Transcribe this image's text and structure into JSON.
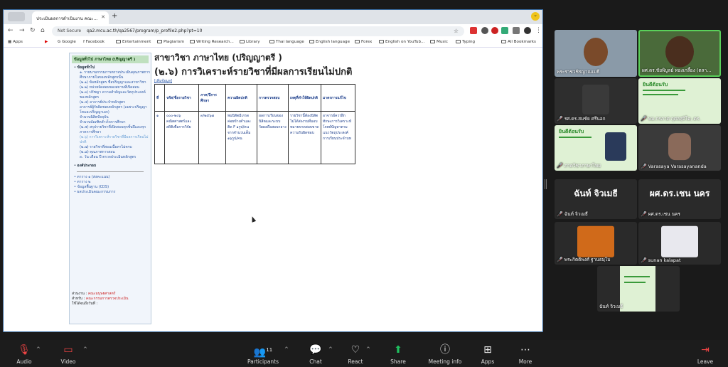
{
  "browser": {
    "tab_title": "ประเมินผลการดำเนินงาน คณะ...",
    "security_label": "Not Secure",
    "url": "qa2.mcu.ac.th/qa2567/program/p_profile2.php?pt=10",
    "bookmarks": [
      "Apps",
      "Google",
      "Facebook",
      "Entertainment",
      "Plagiarism",
      "Writing Research...",
      "Library",
      "Thai language",
      "English language",
      "Forex",
      "English on YouTub...",
      "Music",
      "Typing",
      "All Bookmarks"
    ]
  },
  "leftnav": {
    "heading": "ข้อมูลทั่วไป ภาษาไทย (ปริญญาตรี )",
    "group1": "ข้อมูลทั่วไป",
    "items": [
      "๑. รายนามกรรมการตรวจประเมินคุณภาพการศึกษาภายในของหลักสูตรนั้น",
      "(๒.๑) ข้อหลักสูตร ชื่อปริญญาและสาขาวิชา",
      "(๒.๒) หน่วยจัดสอนของสถานที่เปิดสอน",
      "(๒.๓) ปรัชญา ความสำคัญและวัตถุประสงค์ของหลักสูตร",
      "(๒.๔) อาจารย์ประจำหลักสูตร",
      "อาจารย์ผู้รับผิดชอบหลักสูตร (เฉพาะปริญญาโทและปริญญาเอก)",
      "จำนวนนิสิตปัจจุบัน",
      "จำนวนบัณฑิตสำเร็จการศึกษา",
      "(๒.๕) สรุปรายวิชาที่เปิดสอนทุกชั้นปีและทุกภาคการศึกษา",
      "(๒.๖) การวิเคราะห์รายวิชาที่มีผลการเรียนไม่ปกติ",
      "(๒.๗) รายวิชาที่สอนเนื้อหาไม่ครบ",
      "(๒.๘) คุณภาพการสอน",
      "๓. วัน เดือน ปี ตรวจประเมินหลักสูตร"
    ],
    "group2": "องค์ประกอบ",
    "tables": [
      "ตาราง ๑ (ส่งคะแนน)",
      "ตาราง ๒",
      "ข้อมูลพื้นฐาน (CDS)",
      "ผลประเมินคณะกรรมการ"
    ],
    "footer": {
      "unit_label": "ส่วนงาน :",
      "unit_value": "คณะมนุษยศาสตร์",
      "for_label": "สำหรับ :",
      "for_value": "คณะกรรมการตรวจประเมิน",
      "edit_label": "ใช้ได้จนถึงวันที่ :"
    }
  },
  "main": {
    "title": "สาขาวิชา ภาษาไทย (ปริญญาตรี )",
    "subtitle": "(๒.๖) การวิเคราะห์รายวิชาที่มีผลการเรียนไม่ปกติ",
    "back_link": "[เพิ่มข้อมูล]",
    "table": {
      "headers": [
        "ที่",
        "รหัส/ชื่อรายวิชา",
        "ภาค/ปีการศึกษา",
        "ความผิดปกติ",
        "การตรวจสอบ",
        "เหตุที่ทำให้ผิดปกติ",
        "มาตรการแก้ไข"
      ],
      "row": [
        "๑",
        "๐๐๐-๒๐๖ คณิตศาสตร์และสถิติเพื่อการวิจัย",
        "๓/๒๕๖๗",
        "พบนิสิตมีเกรดค่อยข้างต่ำและติด F ๑รูป/คน จากจำนวนเต็ม ๑๖รูป/คน",
        "ผลการเรียนของนิสิตและระบบวัดผลถือสอบกลาง",
        "รายวิชานี้ต้องนิสิตไม่ได้ส่งงานที่มอบหมายขาดสอบขาดความรับผิดชอบ",
        "อาจารย์ควรฝึกทักษะการวิเคราะห์โจทย์ปัญหาตามแนววัตถุประสงค์การเรียนประจำบท"
      ]
    }
  },
  "participants": [
    {
      "name": "พระราชวชิรญาณเมธี",
      "muted": false
    },
    {
      "name": "ผศ.ดร.ชัยพิบูลย์ ทองเกลี้ยง (ตลา...",
      "muted": false
    },
    {
      "name": "รศ.ดร.สมชัย ศรีนอก",
      "muted": true
    },
    {
      "name": "พม.กรภาศ กุศลสุจิโต, ดร.",
      "muted": true
    },
    {
      "name": "ภาควิชาภาษาไทย",
      "muted": true
    },
    {
      "name": "Varasaya Varasayananda",
      "muted": true
    },
    {
      "name": "ฉันท์ จิวเมธี",
      "muted": true,
      "big_name": "ฉันท์ จิวเมธี"
    },
    {
      "name": "ผศ.ดร.เชน นคร",
      "muted": true,
      "big_name": "ผศ.ดร.เชน นคร"
    },
    {
      "name": "พระกิตติพงศ์ ฐานธมฺโม",
      "muted": true
    },
    {
      "name": "sunan kalapat",
      "muted": true
    },
    {
      "name": "ฉันท์ จิวเมธี",
      "muted": false
    }
  ],
  "poster": {
    "heading": "ยินดีต้อนรับ"
  },
  "meeting_bar": {
    "audio": "Audio",
    "video": "Video",
    "participants": "Participants",
    "participants_count": "11",
    "chat": "Chat",
    "react": "React",
    "share": "Share",
    "meeting_info": "Meeting info",
    "apps": "Apps",
    "more": "More",
    "leave": "Leave"
  }
}
